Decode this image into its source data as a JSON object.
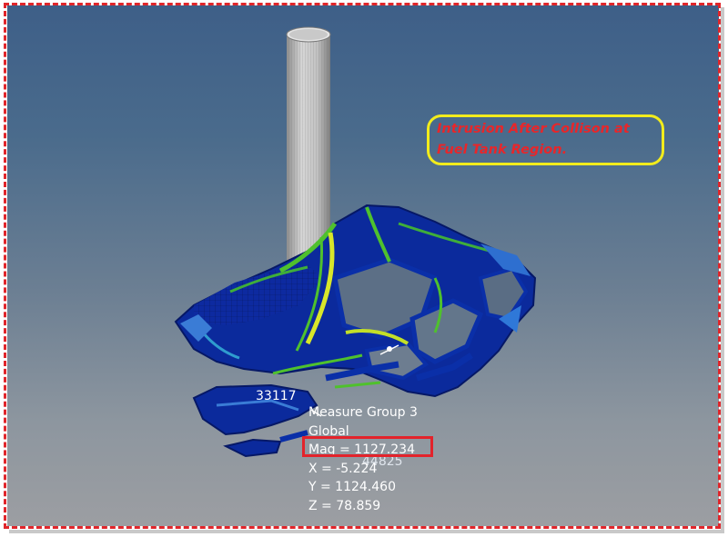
{
  "callout": {
    "line1": "Intrusion After Collison at",
    "line2": "Fuel Tank Region."
  },
  "node_label": "33117",
  "measure": {
    "group": "Measure Group 3",
    "system": "Global",
    "mag": "Mag = 1127.234",
    "x": "X = -5.224",
    "y": "Y = 1124.460",
    "z": "Z = 78.859"
  },
  "overlap_label": "44825",
  "colors": {
    "border": "#e0262b",
    "callout_border": "#f2ec1c",
    "callout_text": "#e8262a",
    "highlight_box": "#e3232b",
    "mesh_blue": "#0a2fa8",
    "mesh_green": "#4fc12d",
    "mesh_yellow": "#d8e62a",
    "pole_grey": "#b9b9b9"
  },
  "icons": [
    "impact-pole",
    "vehicle-frame-mesh"
  ]
}
